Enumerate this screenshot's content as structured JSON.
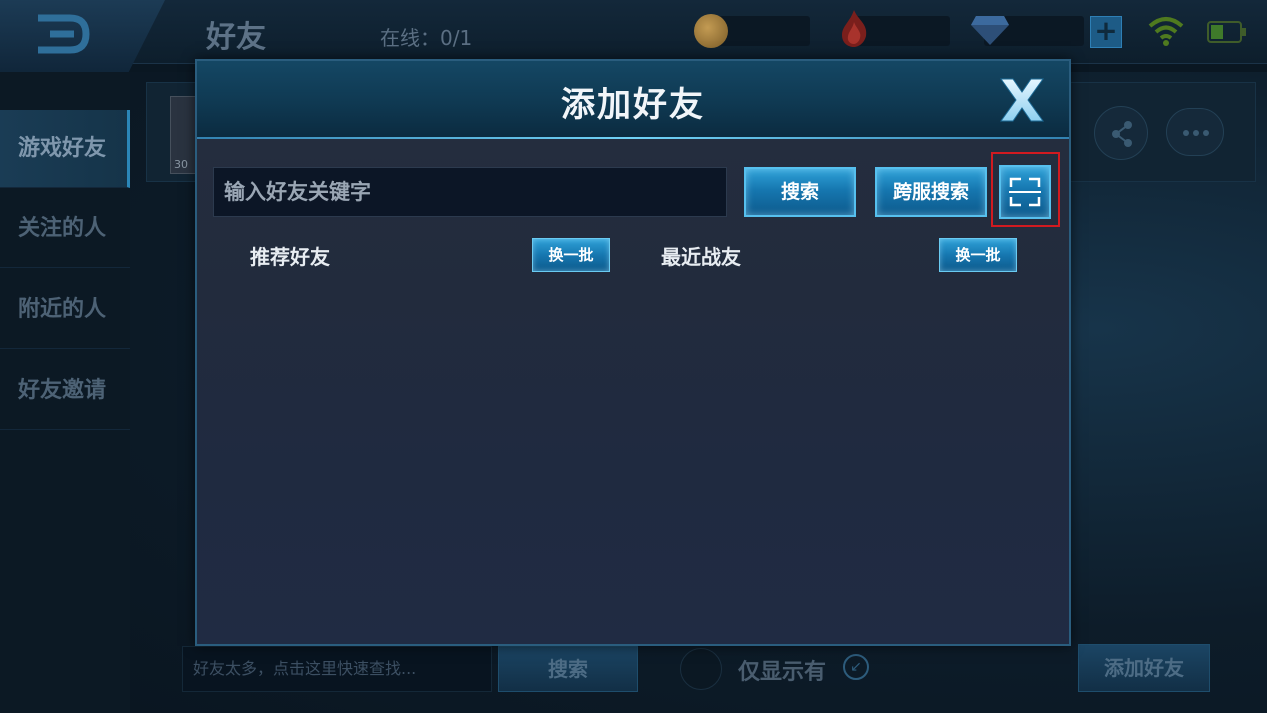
{
  "background": {
    "top_title": "好友",
    "online_status": "在线：0/1",
    "sidebar": {
      "items": [
        {
          "label": "游戏好友"
        },
        {
          "label": "关注的人"
        },
        {
          "label": "附近的人"
        },
        {
          "label": "好友邀请"
        }
      ]
    },
    "friend_card": {
      "level": "30"
    },
    "bottom": {
      "input_placeholder": "好友太多，点击这里快速查找...",
      "search_label": "搜索",
      "only_show_label": "仅显示有",
      "add_friend_label": "添加好友"
    }
  },
  "modal": {
    "title": "添加好友",
    "search_placeholder": "输入好友关键字",
    "search_label": "搜索",
    "cross_search_label": "跨服搜索",
    "recommended_label": "推荐好友",
    "recent_label": "最近战友",
    "refresh_label": "换一批"
  },
  "colors": {
    "accent_blue": "#1677b0",
    "highlight_red": "#d11a20",
    "header_blue": "#144764"
  },
  "icons": [
    "back-icon",
    "coin-icon",
    "flame-icon",
    "diamond-icon",
    "plus-icon",
    "wifi-icon",
    "battery-icon",
    "share-icon",
    "chat-icon",
    "close-icon",
    "scan-icon"
  ]
}
